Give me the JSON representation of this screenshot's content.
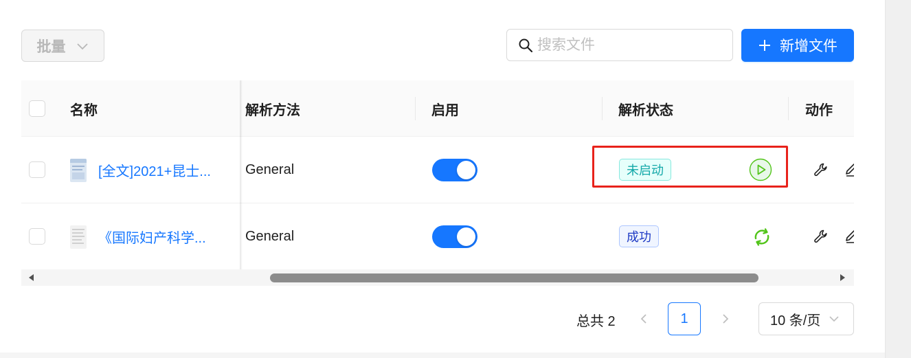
{
  "toolbar": {
    "bulk_label": "批量",
    "search_placeholder": "搜索文件",
    "add_label": "新增文件"
  },
  "table": {
    "columns": [
      "名称",
      "解析方法",
      "启用",
      "解析状态",
      "动作"
    ],
    "rows": [
      {
        "name": "[全文]2021+昆士...",
        "parser": "General",
        "enabled": true,
        "status": "未启动",
        "status_color": "cyan",
        "status_action_icon": "play-circle-icon"
      },
      {
        "name": "《国际妇产科学...",
        "parser": "General",
        "enabled": true,
        "status": "成功",
        "status_color": "blue",
        "status_action_icon": "sync-icon"
      }
    ]
  },
  "pagination": {
    "total_label": "总共 2",
    "current_page": "1",
    "page_size_label": "10 条/页"
  },
  "colors": {
    "primary": "#1677ff",
    "success": "#52c41a",
    "highlight": "#e8221b"
  }
}
